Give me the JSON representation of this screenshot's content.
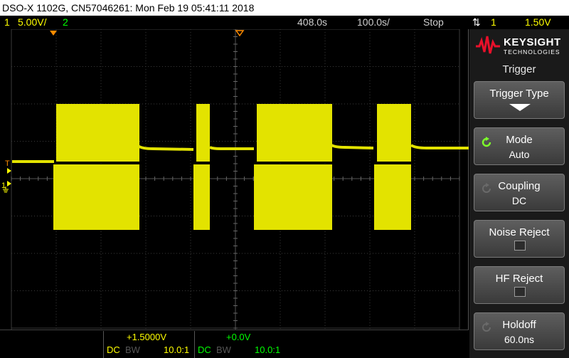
{
  "title": "DSO-X 1102G, CN57046261: Mon Feb 19 05:41:11 2018",
  "status": {
    "ch1_number": "1",
    "ch1_scale": "5.00V/",
    "ch2_number": "2",
    "delay": "408.0s",
    "timebase": "100.0s/",
    "run_state": "Stop",
    "trigger_channel": "1",
    "trigger_level": "1.50V"
  },
  "screen_markers": {
    "trigger_marker": "T",
    "ch1_marker": "1"
  },
  "channels": [
    {
      "offset": "+1.5000V",
      "coupling": "DC",
      "bw": "BW",
      "probe": "10.0:1"
    },
    {
      "offset": "+0.0V",
      "coupling": "DC",
      "bw": "BW",
      "probe": "10.0:1"
    }
  ],
  "colors": {
    "ch1": "#ffff00",
    "ch2": "#00ff00",
    "trace": "#e3e300",
    "trigger_marker": "#ff8c00"
  },
  "brand": {
    "name": "KEYSIGHT",
    "sub": "TECHNOLOGIES"
  },
  "menu": {
    "title": "Trigger",
    "softkeys": [
      {
        "label": "Trigger Type",
        "value": ""
      },
      {
        "label": "Mode",
        "value": "Auto"
      },
      {
        "label": "Coupling",
        "value": "DC"
      },
      {
        "label": "Noise Reject",
        "value": ""
      },
      {
        "label": "HF Reject",
        "value": ""
      },
      {
        "label": "Holdoff",
        "value": "60.0ns"
      }
    ]
  }
}
